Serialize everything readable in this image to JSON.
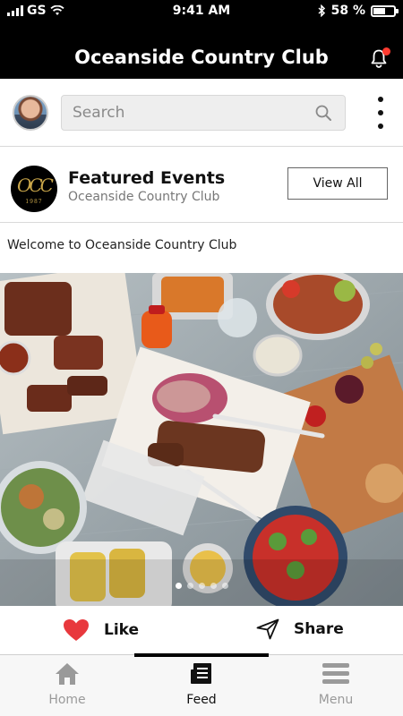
{
  "status_bar": {
    "carrier": "GS",
    "time": "9:41 AM",
    "battery": "58 %"
  },
  "header": {
    "title": "Oceanside Country Club",
    "notification_icon": "bell-icon",
    "notification_badge_color": "#ff3b30"
  },
  "search": {
    "placeholder": "Search"
  },
  "featured": {
    "title": "Featured Events",
    "subtitle": "Oceanside Country Club",
    "logo_monogram": "OCC",
    "logo_year": "1987",
    "view_all_label": "View All"
  },
  "post": {
    "text": "Welcome to Oceanside Country Club",
    "image_icon": "food-spread-photo",
    "carousel_pages": 5,
    "carousel_active_index": 0
  },
  "actions": {
    "like_label": "Like",
    "share_label": "Share",
    "like_color": "#e8383d"
  },
  "tabs": [
    {
      "label": "Home",
      "icon": "home-icon",
      "active": false
    },
    {
      "label": "Feed",
      "icon": "feed-icon",
      "active": true
    },
    {
      "label": "Menu",
      "icon": "menu-icon",
      "active": false
    }
  ]
}
